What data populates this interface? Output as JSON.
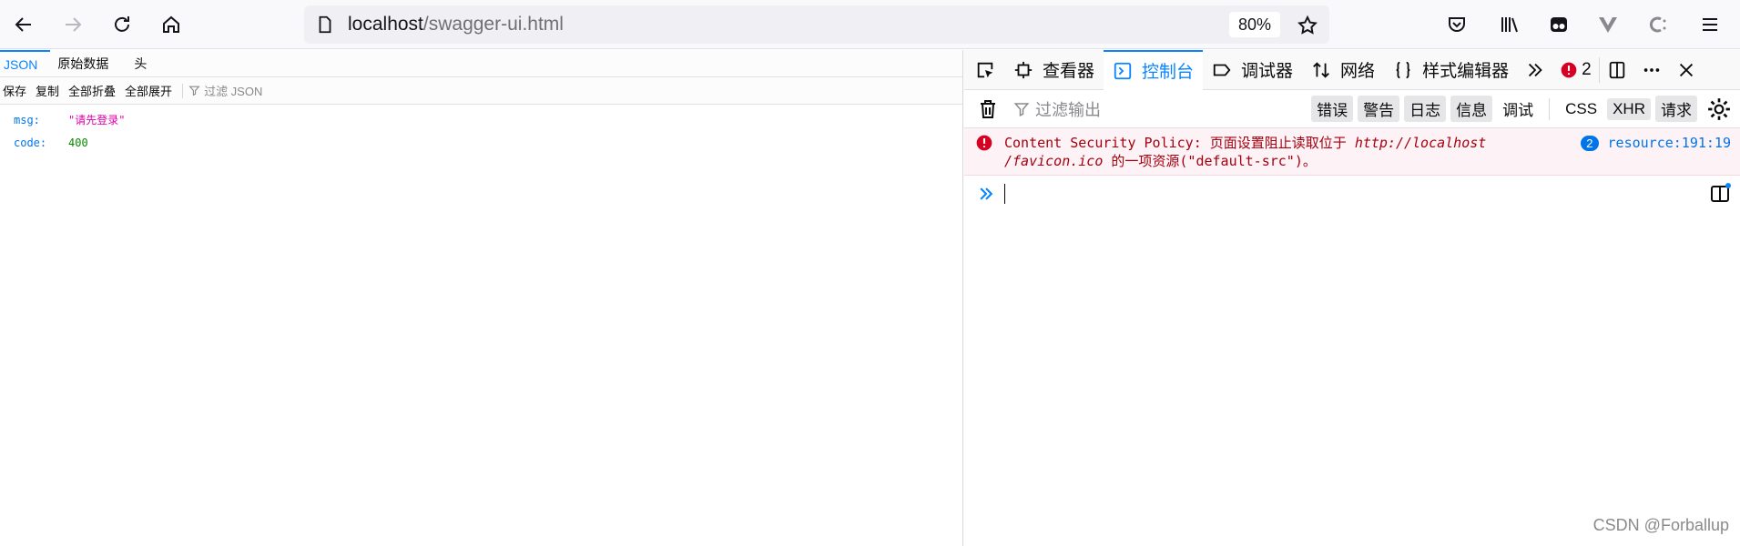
{
  "browser": {
    "url_host": "localhost",
    "url_path": "/swagger-ui.html",
    "zoom": "80%"
  },
  "json_viewer": {
    "tabs": [
      "JSON",
      "原始数据",
      "头"
    ],
    "toolbar": [
      "保存",
      "复制",
      "全部折叠",
      "全部展开"
    ],
    "filter_placeholder": "过滤 JSON",
    "rows": [
      {
        "key": "msg:",
        "value": "\"请先登录\"",
        "type": "string"
      },
      {
        "key": "code:",
        "value": "400",
        "type": "number"
      }
    ]
  },
  "devtools": {
    "tabs": [
      "查看器",
      "控制台",
      "调试器",
      "网络",
      "样式编辑器"
    ],
    "active_tab": "控制台",
    "error_count": "2",
    "filter_placeholder": "过滤输出",
    "levels": [
      "错误",
      "警告",
      "日志",
      "信息",
      "调试"
    ],
    "extra_filters": [
      "CSS",
      "XHR",
      "请求"
    ],
    "message": {
      "line1_prefix": "Content Security Policy: 页面设置阻止读取位于 ",
      "line1_url": "http://localhost",
      "line2_url": "/favicon.ico",
      "line2_suffix": " 的一项资源(\"default-src\")。",
      "repeat_count": "2",
      "location": "resource:191:19"
    }
  },
  "watermark": "CSDN @Forballup",
  "colors": {
    "accent": "#0a84ff",
    "error": "#d70022"
  }
}
